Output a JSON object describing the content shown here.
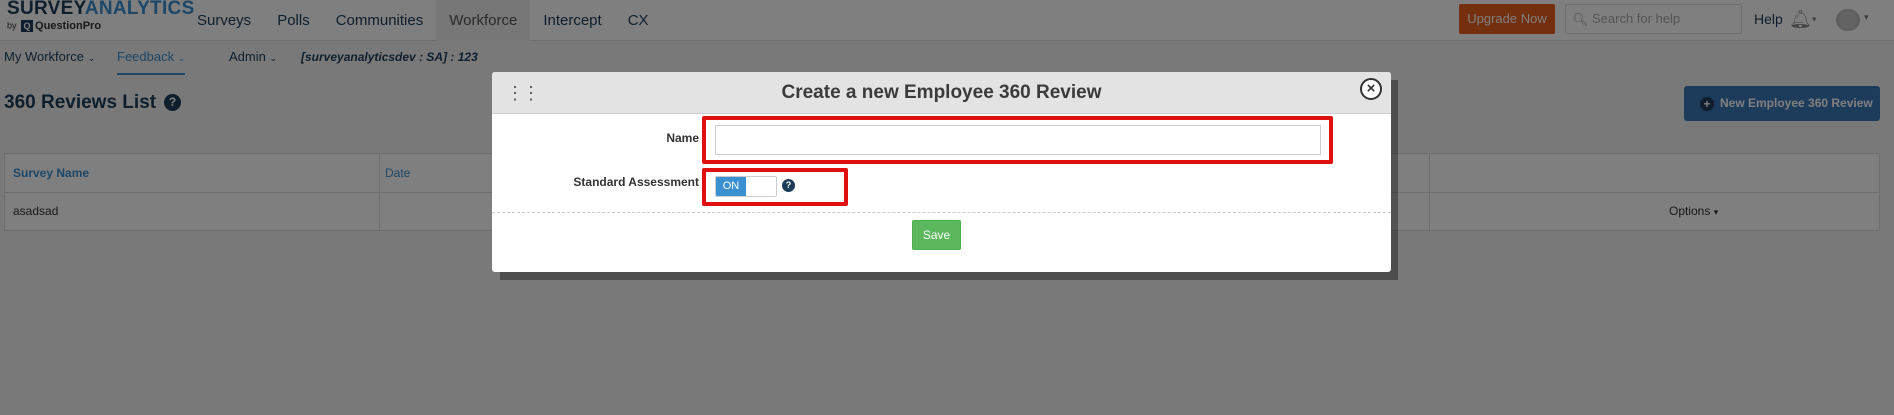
{
  "logo": {
    "primary": "SURVEY",
    "accent": "ANALYTICS",
    "by": "by",
    "brand": "QuestionPro"
  },
  "topnav": {
    "links": [
      "Surveys",
      "Polls",
      "Communities",
      "Workforce",
      "Intercept",
      "CX"
    ],
    "upgrade_label": "Upgrade Now",
    "search_placeholder": "Search for help",
    "help_label": "Help"
  },
  "subnav": {
    "my_workforce": "My Workforce",
    "feedback": "Feedback",
    "admin": "Admin",
    "account": "[surveyanalyticsdev : SA] : 123"
  },
  "page": {
    "title": "360 Reviews List",
    "new_button": "New Employee 360 Review"
  },
  "table": {
    "headers": {
      "survey_name": "Survey Name",
      "date": "Date"
    },
    "rows": [
      {
        "survey_name": "asadsad",
        "options": "Options"
      }
    ]
  },
  "modal": {
    "title": "Create a new Employee 360 Review",
    "name_label": "Name",
    "name_value": "",
    "standard_assessment_label": "Standard Assessment",
    "toggle_state": "ON",
    "save_label": "Save"
  },
  "colors": {
    "accent_blue": "#3a8fd0",
    "navy": "#1d3c5a",
    "upgrade_orange": "#e8601c",
    "save_green": "#5cb85c",
    "highlight_red": "#e01010"
  }
}
